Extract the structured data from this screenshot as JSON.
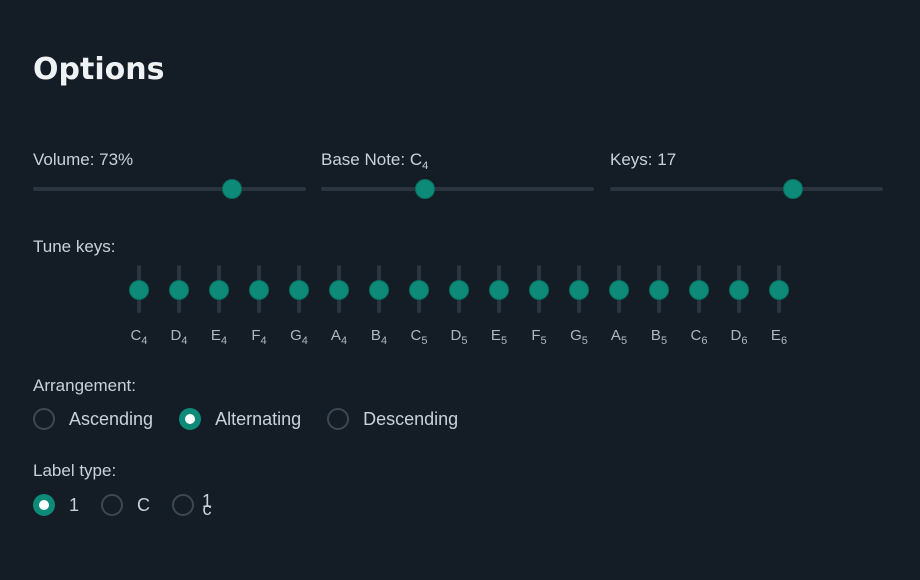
{
  "header": {
    "title": "Options"
  },
  "sliders": [
    {
      "id": "volume",
      "label": "Volume: 73%",
      "value_percent": 73
    },
    {
      "id": "base-note",
      "label_prefix": "Base Note: ",
      "note": "C",
      "octave": "4",
      "value_percent": 38
    },
    {
      "id": "keys",
      "label": "Keys: 17",
      "value_percent": 67
    }
  ],
  "tune": {
    "label": "Tune keys:",
    "keys": [
      {
        "note": "C",
        "octave": "4"
      },
      {
        "note": "D",
        "octave": "4"
      },
      {
        "note": "E",
        "octave": "4"
      },
      {
        "note": "F",
        "octave": "4"
      },
      {
        "note": "G",
        "octave": "4"
      },
      {
        "note": "A",
        "octave": "4"
      },
      {
        "note": "B",
        "octave": "4"
      },
      {
        "note": "C",
        "octave": "5"
      },
      {
        "note": "D",
        "octave": "5"
      },
      {
        "note": "E",
        "octave": "5"
      },
      {
        "note": "F",
        "octave": "5"
      },
      {
        "note": "G",
        "octave": "5"
      },
      {
        "note": "A",
        "octave": "5"
      },
      {
        "note": "B",
        "octave": "5"
      },
      {
        "note": "C",
        "octave": "6"
      },
      {
        "note": "D",
        "octave": "6"
      },
      {
        "note": "E",
        "octave": "6"
      }
    ]
  },
  "arrangement": {
    "label": "Arrangement:",
    "options": [
      {
        "label": "Ascending",
        "checked": false
      },
      {
        "label": "Alternating",
        "checked": true
      },
      {
        "label": "Descending",
        "checked": false
      }
    ]
  },
  "label_type": {
    "label": "Label type:",
    "options": [
      {
        "label": "1",
        "checked": true
      },
      {
        "label": "C",
        "checked": false
      },
      {
        "label_top": "1",
        "label_bottom": "c",
        "checked": false
      }
    ]
  }
}
